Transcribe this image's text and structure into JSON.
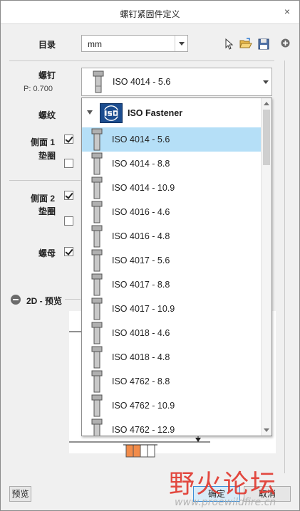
{
  "window": {
    "title": "螺钉紧固件定义",
    "close_glyph": "×"
  },
  "directory": {
    "label": "目录",
    "value": "mm"
  },
  "toolbar_icons": [
    "pointer-icon",
    "open-folder-icon",
    "save-icon",
    "add-icon"
  ],
  "screw": {
    "label": "螺钉",
    "pitch": "P: 0.700",
    "selected": "ISO 4014 - 5.6"
  },
  "thread": {
    "label": "螺纹"
  },
  "side1": {
    "label_line1": "侧面 1",
    "label_line2": "垫圈",
    "checked_a": true,
    "checked_b": false
  },
  "side2": {
    "label_line1": "侧面 2",
    "label_line2": "垫圈",
    "checked_a": true,
    "checked_b": false
  },
  "nut": {
    "label": "螺母",
    "checked": true
  },
  "preview": {
    "label": "2D - 预览"
  },
  "dropdown": {
    "group": "ISO Fastener",
    "selected_index": 0,
    "items": [
      "ISO 4014 - 5.6",
      "ISO 4014 - 8.8",
      "ISO 4014 - 10.9",
      "ISO 4016 - 4.6",
      "ISO 4016 - 4.8",
      "ISO 4017 - 5.6",
      "ISO 4017 - 8.8",
      "ISO 4017 - 10.9",
      "ISO 4018 - 4.6",
      "ISO 4018 - 4.8",
      "ISO 4762 - 8.8",
      "ISO 4762 - 10.9",
      "ISO 4762 - 12.9"
    ]
  },
  "buttons": {
    "preview": "预览",
    "ok": "确定",
    "cancel": "取消"
  },
  "watermark": {
    "text": "野火论坛",
    "url": "www.proewildfire.cn"
  },
  "colors": {
    "selection": "#b5dff7",
    "accent": "#3d8ed6",
    "watermark_red": "#e0352b"
  }
}
